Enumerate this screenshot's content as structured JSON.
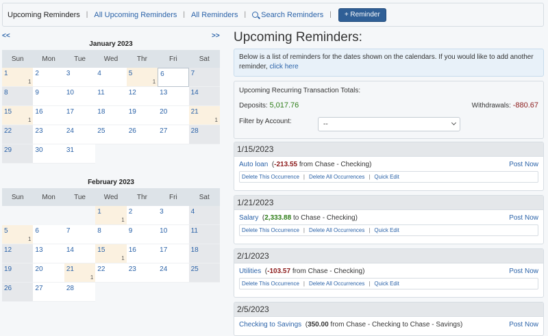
{
  "nav": {
    "upcoming": "Upcoming Reminders",
    "all_upcoming": "All Upcoming Reminders",
    "all": "All Reminders",
    "search": "Search Reminders",
    "add": "+ Reminder"
  },
  "pager": {
    "prev": "<<",
    "next": ">>"
  },
  "calendars": [
    {
      "title": "January 2023",
      "weekdays": [
        "Sun",
        "Mon",
        "Tue",
        "Wed",
        "Thr",
        "Fri",
        "Sat"
      ],
      "lead_blank": 0,
      "days": 31,
      "reminders": {
        "1": "1",
        "5": "1",
        "15": "1",
        "21": "1"
      },
      "today": 6
    },
    {
      "title": "February 2023",
      "weekdays": [
        "Sun",
        "Mon",
        "Tue",
        "Wed",
        "Thr",
        "Fri",
        "Sat"
      ],
      "lead_blank": 3,
      "days": 28,
      "reminders": {
        "1": "1",
        "5": "1",
        "15": "1",
        "21": "1"
      },
      "today": null
    }
  ],
  "main": {
    "title": "Upcoming Reminders:",
    "info_text": "Below is a list of reminders for the dates shown on the calendars. If you would like to add another reminder,",
    "info_link": "click here",
    "totals": {
      "title": "Upcoming Recurring Transaction Totals:",
      "deposits_label": "Deposits:",
      "deposits_value": "5,017.76",
      "withdrawals_label": "Withdrawals:",
      "withdrawals_value": "-880.67",
      "filter_label": "Filter by Account:",
      "filter_value": "--"
    },
    "actions": {
      "delete_one": "Delete This Occurrence",
      "delete_all": "Delete All Occurrences",
      "quick_edit": "Quick Edit",
      "post_now": "Post Now"
    },
    "groups": [
      {
        "date": "1/15/2023",
        "name": "Auto loan",
        "amount": "-213.55",
        "desc": " from Chase - Checking)"
      },
      {
        "date": "1/21/2023",
        "name": "Salary",
        "amount": "2,333.88",
        "desc": " to Chase - Checking)"
      },
      {
        "date": "2/1/2023",
        "name": "Utilities",
        "amount": "-103.57",
        "desc": " from Chase - Checking)"
      },
      {
        "date": "2/5/2023",
        "name": "Checking to Savings",
        "amount": "350.00",
        "desc": " from Chase - Checking to Chase - Savings)"
      }
    ]
  },
  "colors": {
    "accent": "#2a62a8",
    "button": "#2f5f96",
    "negative": "#8b1a1a",
    "positive": "#2d7d17"
  }
}
